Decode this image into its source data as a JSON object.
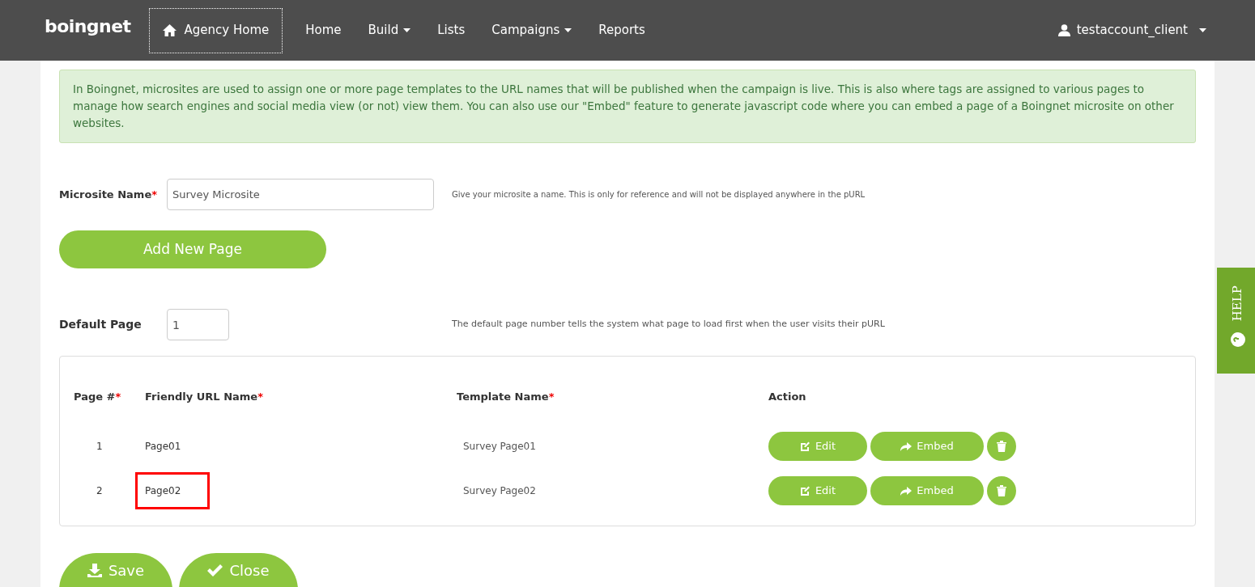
{
  "navbar": {
    "logo": "boingnet",
    "agency_home": "Agency Home",
    "items": [
      {
        "label": "Home",
        "dropdown": false
      },
      {
        "label": "Build",
        "dropdown": true
      },
      {
        "label": "Lists",
        "dropdown": false
      },
      {
        "label": "Campaigns",
        "dropdown": true
      },
      {
        "label": "Reports",
        "dropdown": false
      }
    ],
    "user": "testaccount_client"
  },
  "info": "In Boingnet, microsites are used to assign one or more page templates to the URL names that will be published when the campaign is live. This is also where tags are assigned to various pages to manage how search engines and social media view (or not) view them. You can also use our \"Embed\" feature to generate javascript code where you can embed a page of a Boingnet microsite on other websites.",
  "microsite_name": {
    "label": "Microsite Name",
    "required": "*",
    "value": "Survey Microsite",
    "hint": "Give your microsite a name. This is only for reference and will not be displayed anywhere in the pURL"
  },
  "add_page_button": "Add New Page",
  "default_page": {
    "label": "Default Page",
    "value": "1",
    "hint": "The default page number tells the system what page to load first when the user visits their pURL"
  },
  "table": {
    "columns": [
      {
        "label": "Page #",
        "required": true
      },
      {
        "label": "Friendly URL Name",
        "required": true
      },
      {
        "label": "Template Name",
        "required": true
      },
      {
        "label": "Action",
        "required": false
      }
    ],
    "required_mark": "*",
    "rows": [
      {
        "page": "1",
        "url_name": "Page01",
        "template": "Survey Page01",
        "highlighted": false,
        "edit": "Edit",
        "embed": "Embed"
      },
      {
        "page": "2",
        "url_name": "Page02",
        "template": "Survey Page02",
        "highlighted": true,
        "edit": "Edit",
        "embed": "Embed"
      }
    ]
  },
  "buttons": [
    {
      "kind": "save",
      "label": "Save"
    },
    {
      "kind": "close",
      "label": "Close"
    }
  ],
  "help_tab": "HELP"
}
